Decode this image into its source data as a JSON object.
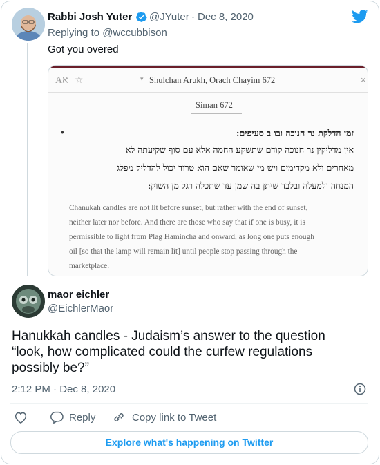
{
  "colors": {
    "accent": "#1d9bf0",
    "muted": "#536471",
    "text": "#0f1419",
    "border": "#cfd9de"
  },
  "parent_tweet": {
    "author_name": "Rabbi Josh Yuter",
    "handle": "@JYuter",
    "separator": "·",
    "date": "Dec 8, 2020",
    "replying_to_prefix": "Replying to",
    "replying_to_handle": "@wccubbison",
    "text": "Got you overed",
    "verified_icon": "verified-badge-icon"
  },
  "quoted_image": {
    "toolbar_left": "Aא",
    "book_title": "Shulchan Arukh, Orach Chayim 672",
    "siman": "Siman 672",
    "bullet": "•",
    "hebrew_heading": "זמן הדלקת נר חנוכה ובו ב סעיפים:",
    "hebrew_lines": [
      "אין מדליקין נר חנוכה קודם שתשקע החמה אלא עם סוף שקיעתה לא",
      "מאחרים ולא מקדימים ויש מי שאומר שאם הוא טרוד יכול להדליק מפלג",
      "המנחה ולמעלה ובלבד שיתן בה שמן עד שתכלה רגל מן השוק:"
    ],
    "english_lines": [
      "Chanukah candles are not lit before sunset, but rather with the end of sunset,",
      "neither later nor before. And there are those who say that if one is busy, it is",
      "permissible to light from Plag Haminchа and onward, as long one puts enough",
      "oil [so that the lamp will remain lit] until people stop passing through the",
      "marketplace."
    ]
  },
  "main_tweet": {
    "author_name": "maor eichler",
    "handle": "@EichlerMaor",
    "text": "Hanukkah candles - Judaism’s answer to the question “look, how complicated could the curfew regulations possibly be?”",
    "time": "2:12 PM",
    "separator": "·",
    "date": "Dec 8, 2020"
  },
  "actions": {
    "reply_label": "Reply",
    "copy_link_label": "Copy link to Tweet"
  },
  "footer": {
    "explore_label": "Explore what's happening on Twitter"
  }
}
